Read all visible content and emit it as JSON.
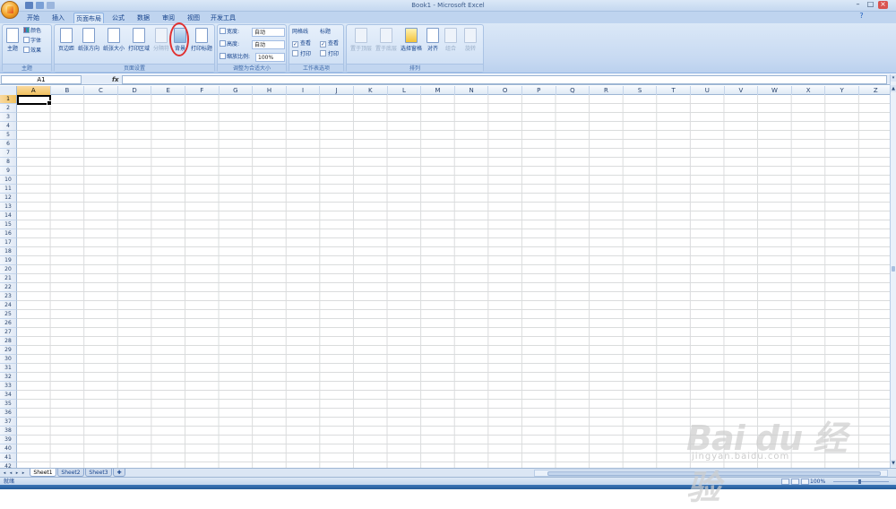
{
  "window": {
    "title": "Book1 - Microsoft Excel"
  },
  "tabs": [
    {
      "label": "开始"
    },
    {
      "label": "插入"
    },
    {
      "label": "页面布局"
    },
    {
      "label": "公式"
    },
    {
      "label": "数据"
    },
    {
      "label": "审阅"
    },
    {
      "label": "视图"
    },
    {
      "label": "开发工具"
    }
  ],
  "active_tab": "页面布局",
  "ribbon": {
    "theme": {
      "big": "主题",
      "colors": "颜色",
      "fonts": "字体",
      "effects": "效果",
      "group": "主题"
    },
    "page_setup": {
      "margins": "页边距",
      "orientation": "纸张方向",
      "size": "纸张大小",
      "print_area": "打印区域",
      "breaks": "分隔符",
      "background": "背景",
      "print_titles": "打印标题",
      "group": "页面设置"
    },
    "scale": {
      "width_label": "宽度:",
      "width_value": "自动",
      "height_label": "高度:",
      "height_value": "自动",
      "scale_label": "缩放比例:",
      "scale_value": "100%",
      "group": "调整为合适大小"
    },
    "sheet_options": {
      "gridlines": "网格线",
      "headings": "标题",
      "view": "查看",
      "print": "打印",
      "group": "工作表选项"
    },
    "arrange": {
      "bring_forward": "置于顶层",
      "send_backward": "置于底层",
      "selection_pane": "选择窗格",
      "align": "对齐",
      "group_btn": "组合",
      "rotate": "旋转",
      "group": "排列"
    }
  },
  "formula_bar": {
    "name_box": "A1",
    "fx": "fx",
    "value": ""
  },
  "columns": [
    "A",
    "B",
    "C",
    "D",
    "E",
    "F",
    "G",
    "H",
    "I",
    "J",
    "K",
    "L",
    "M",
    "N",
    "O",
    "P",
    "Q",
    "R",
    "S",
    "T",
    "U",
    "V",
    "W",
    "X",
    "Y",
    "Z"
  ],
  "rows": [
    "1",
    "2",
    "3",
    "4",
    "5",
    "6",
    "7",
    "8",
    "9",
    "10",
    "11",
    "12",
    "13",
    "14",
    "15",
    "16",
    "17",
    "18",
    "19",
    "20",
    "21",
    "22",
    "23",
    "24",
    "25",
    "26",
    "27",
    "28",
    "29",
    "30",
    "31",
    "32",
    "33",
    "34",
    "35",
    "36",
    "37",
    "38",
    "39",
    "40",
    "41",
    "42"
  ],
  "sheets": [
    "Sheet1",
    "Sheet2",
    "Sheet3"
  ],
  "active_sheet": "Sheet1",
  "status": {
    "text": "就绪",
    "zoom": "100%"
  },
  "watermark": {
    "main": "Bai du 经验",
    "sub": "jingyan.baidu.com"
  },
  "colors": {
    "accent": "#15428b",
    "selected_header": "#f1c15f",
    "highlight": "#e03030"
  }
}
